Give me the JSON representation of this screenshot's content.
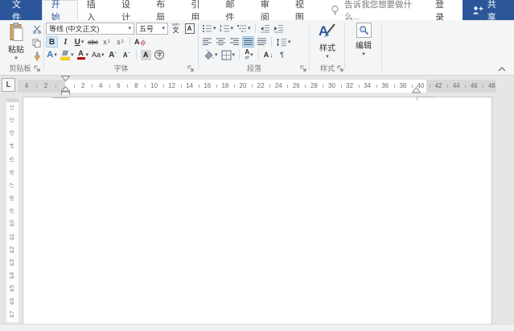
{
  "colors": {
    "accent": "#2b579a",
    "highlight_yellow": "#ffd500",
    "font_color_red": "#c00000"
  },
  "titlebar": {
    "file_tab": "文件",
    "tabs": [
      "开始",
      "插入",
      "设计",
      "布局",
      "引用",
      "邮件",
      "审阅",
      "视图"
    ],
    "active_tab": "开始",
    "tell_me": "告诉我您想要做什么...",
    "sign_in": "登录",
    "share": "共享"
  },
  "ribbon": {
    "clipboard": {
      "paste_label": "粘贴",
      "group_label": "剪贴板"
    },
    "font": {
      "name_value": "等线 (中文正文)",
      "size_value": "五号",
      "bold": "B",
      "italic": "I",
      "underline": "U",
      "strikethrough": "abc",
      "subscript_base": "x",
      "subscript_small": "2",
      "superscript_base": "x",
      "superscript_small": "2",
      "clear_letter": "A",
      "effects_letter": "A",
      "color_letter": "A",
      "case_label": "Aa",
      "grow_letter": "A",
      "grow_mark": "ˆ",
      "shrink_letter": "A",
      "shrink_mark": "ˇ",
      "shading_letter": "A",
      "enclose_char": "字",
      "pinyin_top": "wén",
      "pinyin_char": "文",
      "border_letter": "A",
      "group_label": "字体"
    },
    "paragraph": {
      "asian_letter": "A",
      "asian_arrows": "⇄",
      "sort_letter": "A",
      "sort_arrow": "↓",
      "pilcrow": "¶",
      "group_label": "段落"
    },
    "styles": {
      "icon_letter": "A",
      "button_label": "样式",
      "group_label": "样式"
    },
    "editing": {
      "button_label": "编辑"
    }
  },
  "ruler": {
    "tab_selector": "L",
    "left_margin_numbers": [
      "4",
      "2"
    ],
    "main_numbers": [
      "2",
      "4",
      "6",
      "8",
      "10",
      "12",
      "14",
      "16",
      "18",
      "20",
      "22",
      "24",
      "26",
      "28",
      "30",
      "32",
      "34",
      "36",
      "38",
      "40"
    ],
    "right_margin_numbers": [
      "42",
      "44",
      "46",
      "48"
    ],
    "vertical_numbers": [
      "1",
      "2",
      "3",
      "4",
      "5",
      "6",
      "7",
      "8",
      "9",
      "10",
      "11",
      "12",
      "13",
      "14",
      "15",
      "16",
      "17"
    ]
  },
  "glyphs": {
    "dropdown": "▾"
  }
}
